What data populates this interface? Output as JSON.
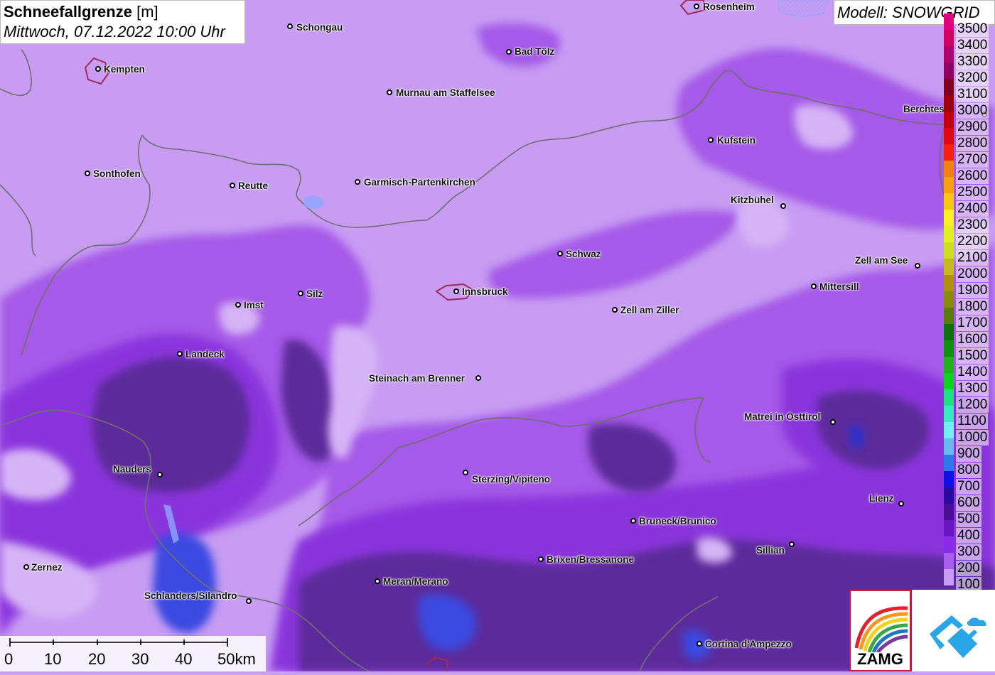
{
  "header": {
    "title_bold": "Schneefallgrenze",
    "title_unit": "[m]",
    "subtitle": "Mittwoch, 07.12.2022 10:00 Uhr",
    "model": "Modell: SNOWGRID"
  },
  "legend": {
    "items": [
      {
        "label": "100",
        "color": "#c79cf2"
      },
      {
        "label": "200",
        "color": "#a95cf0"
      },
      {
        "label": "300",
        "color": "#8a2be8"
      },
      {
        "label": "400",
        "color": "#6a16c4"
      },
      {
        "label": "500",
        "color": "#4a0f94"
      },
      {
        "label": "600",
        "color": "#2a0aa0"
      },
      {
        "label": "700",
        "color": "#1010e0"
      },
      {
        "label": "800",
        "color": "#2a7ae8"
      },
      {
        "label": "900",
        "color": "#6ab8f0"
      },
      {
        "label": "1000",
        "color": "#70f0f0"
      },
      {
        "label": "1100",
        "color": "#3ce8c0"
      },
      {
        "label": "1200",
        "color": "#20e080"
      },
      {
        "label": "1300",
        "color": "#10d020"
      },
      {
        "label": "1400",
        "color": "#20b020"
      },
      {
        "label": "1500",
        "color": "#109010"
      },
      {
        "label": "1600",
        "color": "#0c700c"
      },
      {
        "label": "1700",
        "color": "#5a7a10"
      },
      {
        "label": "1800",
        "color": "#8a8a10"
      },
      {
        "label": "1900",
        "color": "#b09010"
      },
      {
        "label": "2000",
        "color": "#c8b820"
      },
      {
        "label": "2100",
        "color": "#c8e020"
      },
      {
        "label": "2200",
        "color": "#e0f020"
      },
      {
        "label": "2300",
        "color": "#f8f020"
      },
      {
        "label": "2400",
        "color": "#f8c810"
      },
      {
        "label": "2500",
        "color": "#f8a010"
      },
      {
        "label": "2600",
        "color": "#f88010"
      },
      {
        "label": "2700",
        "color": "#f82010"
      },
      {
        "label": "2800",
        "color": "#e00810"
      },
      {
        "label": "2900",
        "color": "#c00010"
      },
      {
        "label": "3000",
        "color": "#a00010"
      },
      {
        "label": "3100",
        "color": "#800020"
      },
      {
        "label": "3200",
        "color": "#900060"
      },
      {
        "label": "3300",
        "color": "#b00070"
      },
      {
        "label": "3400",
        "color": "#d00060"
      },
      {
        "label": "3500",
        "color": "#e00080"
      }
    ]
  },
  "cities": [
    {
      "name": "Rosenheim"
    },
    {
      "name": "Schongau"
    },
    {
      "name": "Kempten"
    },
    {
      "name": "Bad Tölz"
    },
    {
      "name": "Murnau am Staffelsee"
    },
    {
      "name": "Berchtes"
    },
    {
      "name": "Kufstein"
    },
    {
      "name": "Sonthofen"
    },
    {
      "name": "Reutte"
    },
    {
      "name": "Garmisch-Partenkirchen"
    },
    {
      "name": "Kitzbühel"
    },
    {
      "name": "Schwaz"
    },
    {
      "name": "Zell am See"
    },
    {
      "name": "Innsbruck"
    },
    {
      "name": "Silz"
    },
    {
      "name": "Mittersill"
    },
    {
      "name": "Imst"
    },
    {
      "name": "Zell am Ziller"
    },
    {
      "name": "Landeck"
    },
    {
      "name": "Steinach am Brenner"
    },
    {
      "name": "Matrei in Osttirol"
    },
    {
      "name": "Nauders"
    },
    {
      "name": "Sterzing/Vipiteno"
    },
    {
      "name": "Lienz"
    },
    {
      "name": "Bruneck/Brunico"
    },
    {
      "name": "Sillian"
    },
    {
      "name": "Brixen/Bressanone"
    },
    {
      "name": "Zernez"
    },
    {
      "name": "Meran/Merano"
    },
    {
      "name": "Schlanders/Silandro"
    },
    {
      "name": "Cortina d'Ampezzo"
    }
  ],
  "scale": {
    "labels": [
      "0",
      "10",
      "20",
      "30",
      "40",
      "50km"
    ]
  },
  "logos": {
    "zamg_text": "ZAMG"
  }
}
